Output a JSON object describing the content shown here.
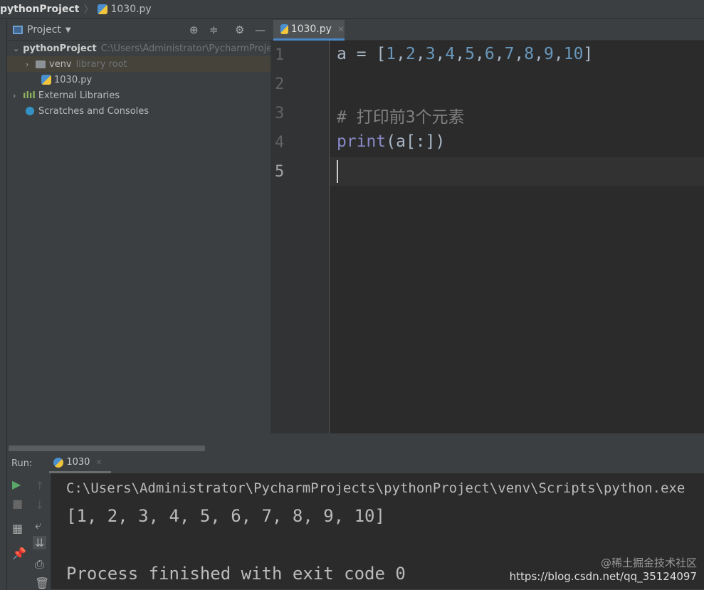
{
  "breadcrumb": {
    "project": "pythonProject",
    "file": "1030.py"
  },
  "project_panel": {
    "title": "Project",
    "tree": [
      {
        "label": "pythonProject",
        "hint": "C:\\Users\\Administrator\\PycharmProjects"
      },
      {
        "label": "venv",
        "hint": "library root"
      },
      {
        "label": "1030.py"
      },
      {
        "label": "External Libraries"
      },
      {
        "label": "Scratches and Consoles"
      }
    ]
  },
  "editor": {
    "tab": "1030.py",
    "lines": [
      "1",
      "2",
      "3",
      "4",
      "5"
    ],
    "code": {
      "l1_a": "a = [",
      "l1_nums": [
        "1",
        "2",
        "3",
        "4",
        "5",
        "6",
        "7",
        "8",
        "9",
        "10"
      ],
      "l1_end": "]",
      "l3": "# 打印前3个元素",
      "l4_fn": "print",
      "l4_rest": "(a[:])"
    }
  },
  "run": {
    "label": "Run:",
    "tab": "1030",
    "output": [
      "C:\\Users\\Administrator\\PycharmProjects\\pythonProject\\venv\\Scripts\\python.exe",
      "[1, 2, 3, 4, 5, 6, 7, 8, 9, 10]",
      "",
      "Process finished with exit code 0"
    ]
  },
  "watermark": {
    "line1": "@稀土掘金技术社区",
    "line2": "https://blog.csdn.net/qq_35124097"
  }
}
